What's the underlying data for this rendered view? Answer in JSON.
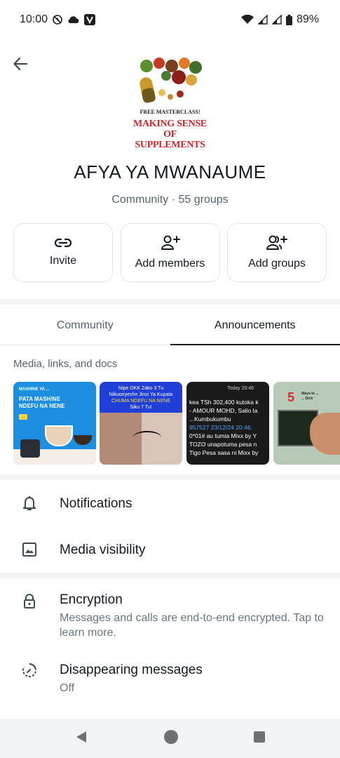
{
  "status_bar": {
    "time": "10:00",
    "battery": "89%",
    "icons": [
      "alarm-off-icon",
      "cloud-icon",
      "v-app-icon",
      "wifi-icon",
      "signal-icon",
      "signal-icon",
      "battery-icon"
    ]
  },
  "header": {
    "back_icon": "arrow-back-icon"
  },
  "community_image": {
    "line1": "FREE MASTERCLASS!",
    "line2": "MAKING SENSE",
    "line3": "OF SUPPLEMENTS"
  },
  "community": {
    "name": "AFYA YA MWANAUME",
    "meta": "Community · 55 groups"
  },
  "actions": [
    {
      "label": "Invite",
      "icon": "link-icon"
    },
    {
      "label": "Add members",
      "icon": "person-add-icon"
    },
    {
      "label": "Add groups",
      "icon": "group-add-icon"
    }
  ],
  "tabs": [
    {
      "label": "Community",
      "active": false
    },
    {
      "label": "Announcements",
      "active": true
    }
  ],
  "media": {
    "title": "Media, links, and docs",
    "thumb1": {
      "l1": "MASHINE YA ...",
      "l2a": "PATA MASHINE",
      "l2b": "NDEFU NA NENE",
      "badge": "..."
    },
    "thumb2": {
      "line1": "Nipe OKK Zako 3 Tu",
      "line2": "Nikuonyeshe Jinsi Ya Kupata",
      "line3": "CHUMA NDEFU NA NENE",
      "line4": "Siku 7 Tu!"
    },
    "thumb3": {
      "time": "Today 20:46",
      "lines": [
        "kea TSh 302,400 kutoka k",
        "- AMOUR MOHD, Salio la",
        "...Kumbukumbu",
        "957527 23/12/24 20:46.",
        "0*01# au tumia Mixx by Y",
        "TOZO unapotuma pesa n",
        "Tigo Pesa sasa ni Mixx by"
      ]
    },
    "thumb4": {
      "number": "5",
      "title1": "Ways to ...",
      "title2": "... Dick"
    }
  },
  "settings": {
    "notifications": {
      "label": "Notifications",
      "icon": "bell-icon"
    },
    "media_visibility": {
      "label": "Media visibility",
      "icon": "image-icon"
    },
    "encryption": {
      "label": "Encryption",
      "sub": "Messages and calls are end-to-end encrypted. Tap to learn more.",
      "icon": "lock-icon"
    },
    "disappearing": {
      "label": "Disappearing messages",
      "sub": "Off",
      "icon": "timer-icon"
    }
  },
  "nav": {
    "back": "nav-back-icon",
    "home": "nav-home-icon",
    "recents": "nav-recents-icon"
  },
  "colors": {
    "text_primary": "#111b21",
    "text_secondary": "#54656f",
    "divider": "#f2f3f5",
    "nav_bg": "#f1f3f5"
  }
}
